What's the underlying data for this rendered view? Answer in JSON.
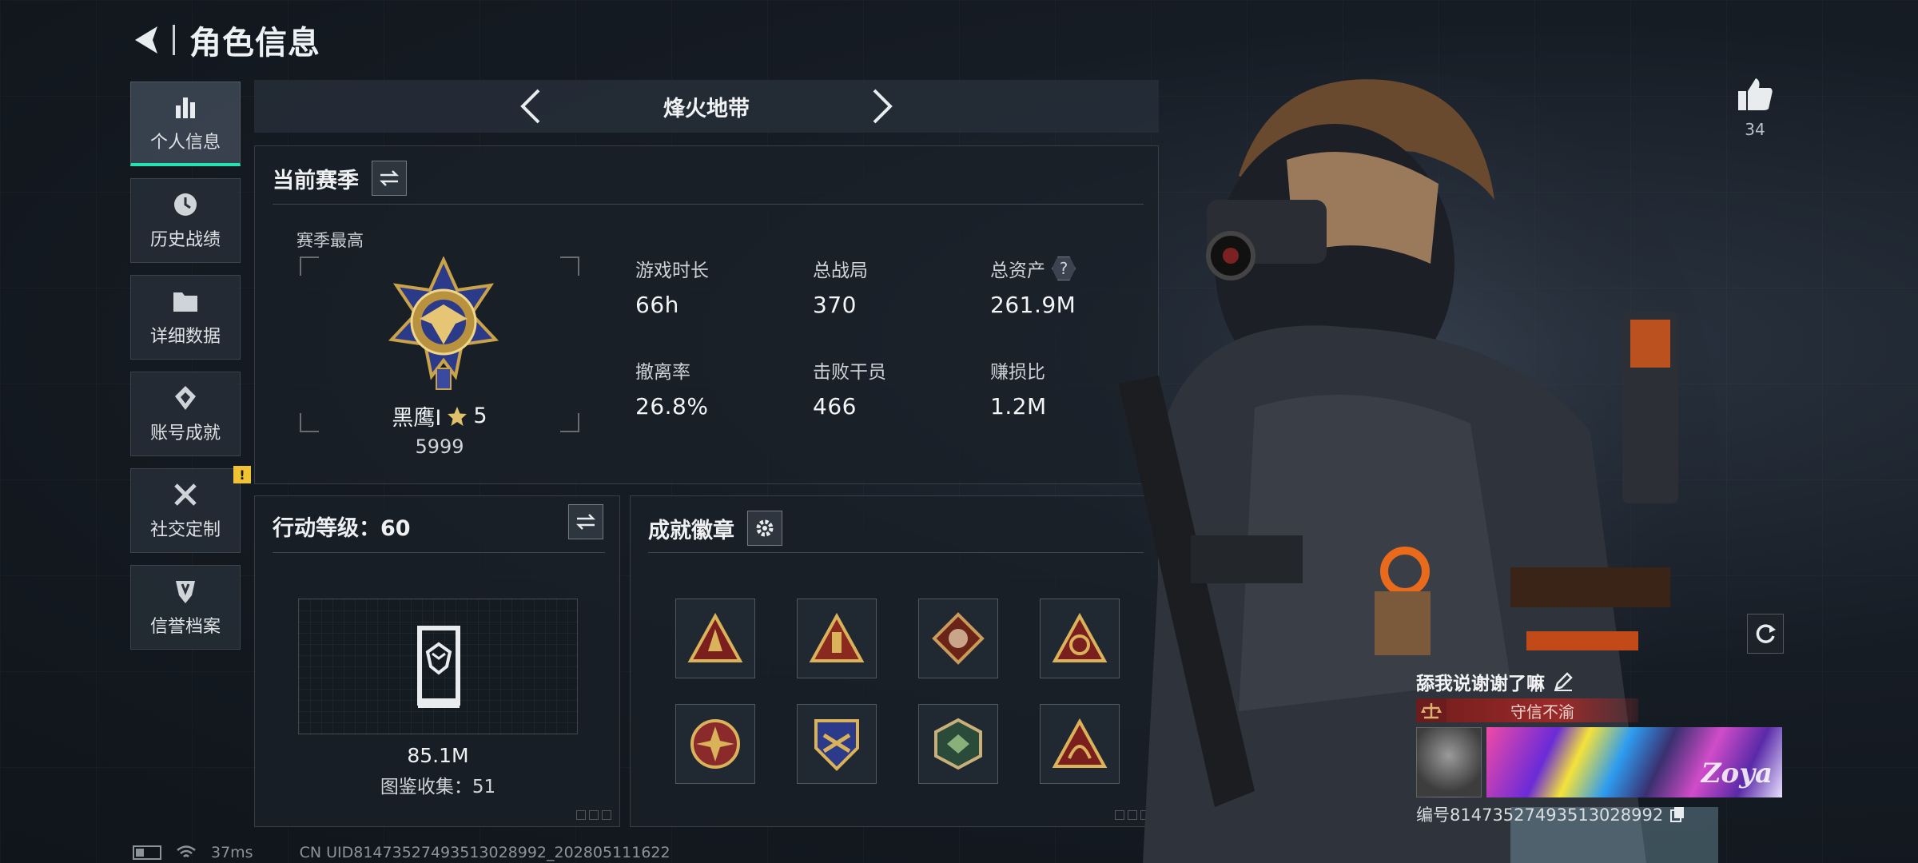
{
  "header": {
    "title": "角色信息"
  },
  "sidebar": {
    "items": [
      {
        "label": "个人信息",
        "icon": "bar-chart-icon",
        "active": true
      },
      {
        "label": "历史战绩",
        "icon": "clock-icon"
      },
      {
        "label": "详细数据",
        "icon": "folder-icon"
      },
      {
        "label": "账号成就",
        "icon": "trophy-icon"
      },
      {
        "label": "社交定制",
        "icon": "tools-icon",
        "badge": "!"
      },
      {
        "label": "信誉档案",
        "icon": "shield-icon"
      }
    ]
  },
  "mode": {
    "title": "烽火地带"
  },
  "season": {
    "title": "当前赛季",
    "highest_label": "赛季最高",
    "rank_name": "黑鹰I",
    "rank_stars": "5",
    "rank_score": "5999",
    "stats": [
      {
        "label": "游戏时长",
        "value": "66h"
      },
      {
        "label": "总战局",
        "value": "370"
      },
      {
        "label": "总资产",
        "value": "261.9M",
        "help": "?"
      },
      {
        "label": "撤离率",
        "value": "26.8%"
      },
      {
        "label": "击败干员",
        "value": "466"
      },
      {
        "label": "赚损比",
        "value": "1.2M"
      }
    ]
  },
  "action": {
    "title": "行动等级：60",
    "collection_value": "85.1M",
    "collection_count": "图鉴收集：51"
  },
  "badges": {
    "title": "成就徽章",
    "items": [
      "badge-1",
      "badge-2",
      "badge-3",
      "badge-4",
      "badge-5",
      "badge-6",
      "badge-7",
      "badge-8"
    ]
  },
  "social": {
    "likes": "34",
    "nickname": "舔我说谢谢了嘛",
    "trust_label": "守信不渝",
    "banner_text": "Zoya",
    "uid": "编号81473527493513028992"
  },
  "status": {
    "ping": "37ms",
    "uid_line": "CN UID81473527493513028992_202805111622"
  },
  "colors": {
    "accent": "#22e3b2",
    "warning": "#f1c232",
    "trust": "#9a2a2a"
  }
}
